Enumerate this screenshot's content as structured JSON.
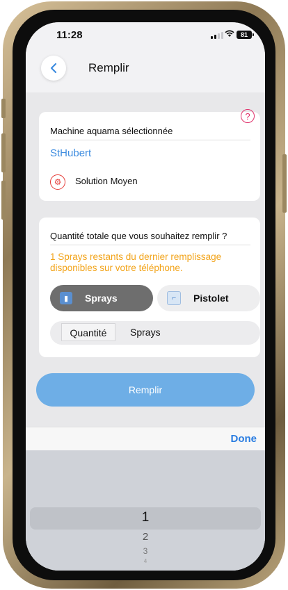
{
  "status": {
    "time": "11:28",
    "battery": "81"
  },
  "nav": {
    "title": "Remplir"
  },
  "machine_card": {
    "heading": "Machine aquama sélectionnée",
    "machine_name": "StHubert",
    "solution": "Solution Moyen"
  },
  "quantity_card": {
    "heading": "Quantité totale que vous souhaitez remplir ?",
    "info": "1 Sprays restants du dernier remplissage disponibles sur votre téléphone.",
    "options": [
      {
        "label": "Sprays",
        "selected": true
      },
      {
        "label": "Pistolet",
        "selected": false
      }
    ],
    "quantity_label": "Quantité",
    "unit": "Sprays"
  },
  "submit_label": "Remplir",
  "keyboard_toolbar": {
    "done_label": "Done"
  },
  "picker": {
    "values": [
      "1",
      "2",
      "3",
      "4"
    ]
  },
  "colors": {
    "accent": "#3f8de0",
    "warning": "#f2a318",
    "button": "#6eaee6",
    "help": "#e0306a"
  }
}
